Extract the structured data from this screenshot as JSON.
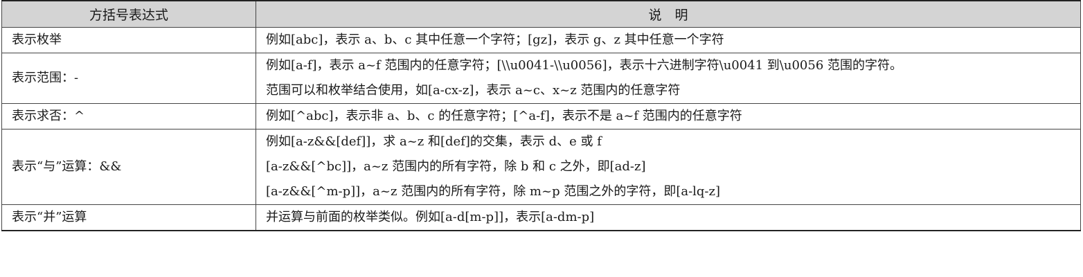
{
  "table": {
    "headers": [
      "方括号表达式",
      "说　明"
    ],
    "rows": [
      {
        "expr": "表示枚举",
        "desc": [
          "例如[abc]，表示 a、b、c 其中任意一个字符；[gz]，表示 g、z 其中任意一个字符"
        ]
      },
      {
        "expr": "表示范围：-",
        "desc": [
          "例如[a-f]，表示 a~f 范围内的任意字符；[\\\\u0041-\\\\u0056]，表示十六进制字符\\u0041 到\\u0056 范围的字符。",
          "范围可以和枚举结合使用，如[a-cx-z]，表示 a~c、x~z 范围内的任意字符"
        ]
      },
      {
        "expr": "表示求否：^",
        "desc": [
          "例如[^abc]，表示非 a、b、c 的任意字符；[^a-f]，表示不是 a~f 范围内的任意字符"
        ]
      },
      {
        "expr": "表示“与”运算：&&",
        "desc": [
          "例如[a-z&&[def]]，求 a~z 和[def]的交集，表示 d、e 或 f",
          "[a-z&&[^bc]]，a~z 范围内的所有字符，除 b 和 c 之外，即[ad-z]",
          "[a-z&&[^m-p]]，a~z 范围内的所有字符，除 m~p 范围之外的字符，即[a-lq-z]"
        ]
      },
      {
        "expr": "表示“并”运算",
        "desc": [
          "并运算与前面的枚举类似。例如[a-d[m-p]]，表示[a-dm-p]"
        ]
      }
    ]
  }
}
